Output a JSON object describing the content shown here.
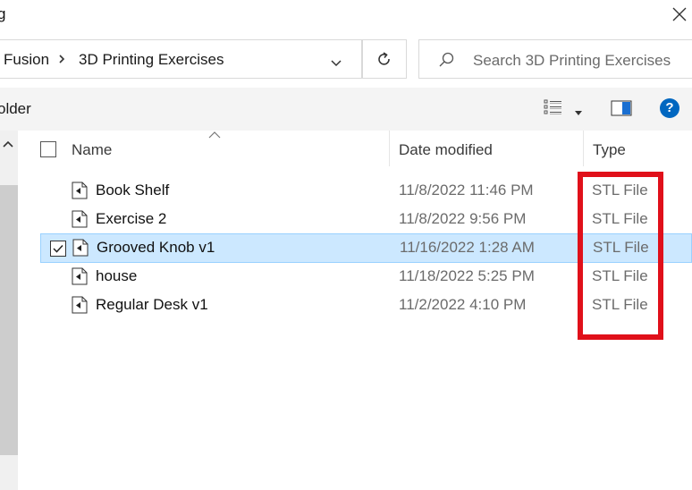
{
  "window": {
    "title": "g",
    "close_icon": "close-icon"
  },
  "address_bar": {
    "breadcrumbs": [
      "Fusion",
      "3D Printing Exercises"
    ],
    "separator_icon": "chevron-right-icon",
    "dropdown_icon": "chevron-down-icon",
    "refresh_icon": "refresh-icon"
  },
  "search": {
    "placeholder": "Search 3D Printing Exercises",
    "icon": "search-icon"
  },
  "command_bar": {
    "new_folder_label": "older",
    "view_icon": "details-view-icon",
    "preview_icon": "preview-pane-icon",
    "help_label": "?"
  },
  "file_list": {
    "columns": [
      "Name",
      "Date modified",
      "Type"
    ],
    "rows": [
      {
        "name": "Book Shelf",
        "date": "11/8/2022 11:46 PM",
        "type": "STL File",
        "selected": false
      },
      {
        "name": "Exercise 2",
        "date": "11/8/2022 9:56 PM",
        "type": "STL File",
        "selected": false
      },
      {
        "name": "Grooved Knob v1",
        "date": "11/16/2022 1:28 AM",
        "type": "STL File",
        "selected": true
      },
      {
        "name": "house",
        "date": "11/18/2022 5:25 PM",
        "type": "STL File",
        "selected": false
      },
      {
        "name": "Regular Desk v1",
        "date": "11/2/2022 4:10 PM",
        "type": "STL File",
        "selected": false
      }
    ]
  },
  "colors": {
    "selection_bg": "#cce8ff",
    "selection_border": "#99d1ff",
    "highlight_annotation": "#e0101a",
    "help_blue": "#0067c0"
  }
}
